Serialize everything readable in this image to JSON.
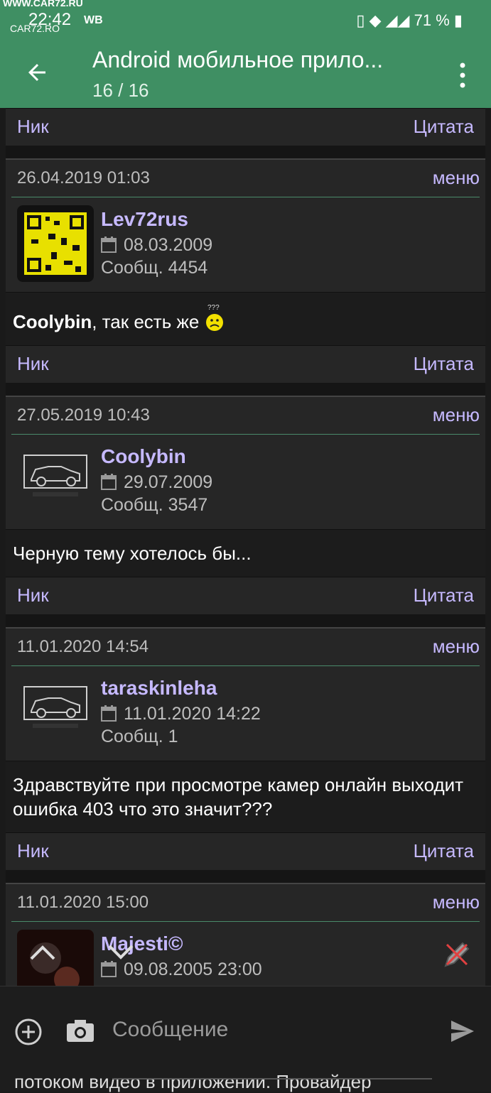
{
  "status": {
    "watermark": "WWW.CAR72.RU",
    "watermark2": "CAR72.RO",
    "time": "22:42",
    "carrier": "WB",
    "battery": "71 %"
  },
  "appbar": {
    "title": "Android мобильное прило...",
    "subtitle": "16 / 16"
  },
  "actions": {
    "nick": "Ник",
    "quote": "Цитата"
  },
  "posts": [
    {
      "date": "26.04.2019 01:03",
      "menu": "меню",
      "user": "Lev72rus",
      "joined": "08.03.2009",
      "count": "Сообщ. 4454",
      "mention": "Coolybin",
      "text": ", так есть же"
    },
    {
      "date": "27.05.2019 10:43",
      "menu": "меню",
      "user": "Coolybin",
      "joined": "29.07.2009",
      "count": "Сообщ. 3547",
      "text": "Черную тему хотелось бы..."
    },
    {
      "date": "11.01.2020 14:54",
      "menu": "меню",
      "user": "taraskinleha",
      "joined": "11.01.2020 14:22",
      "count": "Сообщ. 1",
      "text": "Здравствуйте при просмотре камер онлайн выходит ошибка 403 что это значит???"
    },
    {
      "date": "11.01.2020 15:00",
      "menu": "меню",
      "user": "Majesti©",
      "joined": "09.08.2005 23:00"
    }
  ],
  "compose": {
    "placeholder": "Сообщение",
    "peek_text": "потоком видео в приложении. Провайдер"
  },
  "colors": {
    "accent": "#3f8f63",
    "link": "#c6b9ff"
  }
}
